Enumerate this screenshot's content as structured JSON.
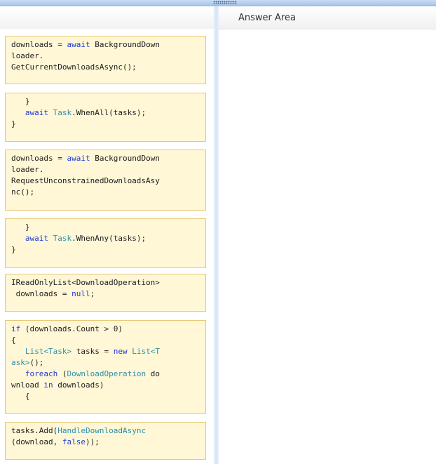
{
  "answer_area": {
    "title": "Answer Area"
  },
  "cards": [
    {
      "id": "c1",
      "lines": [
        [
          {
            "t": "downloads = "
          },
          {
            "t": "await",
            "c": "kw"
          },
          {
            "t": " BackgroundDown"
          }
        ],
        [
          {
            "t": "loader."
          }
        ],
        [
          {
            "t": "GetCurrentDownloadsAsync();"
          }
        ]
      ]
    },
    {
      "id": "c2",
      "lines": [
        [
          {
            "t": "   }"
          }
        ],
        [
          {
            "t": "   "
          },
          {
            "t": "await",
            "c": "kw"
          },
          {
            "t": " "
          },
          {
            "t": "Task",
            "c": "ty"
          },
          {
            "t": ".WhenAll(tasks);"
          }
        ],
        [
          {
            "t": "}"
          }
        ]
      ]
    },
    {
      "id": "c3",
      "lines": [
        [
          {
            "t": "downloads = "
          },
          {
            "t": "await",
            "c": "kw"
          },
          {
            "t": " BackgroundDown"
          }
        ],
        [
          {
            "t": "loader."
          }
        ],
        [
          {
            "t": "RequestUnconstrainedDownloadsAsy"
          }
        ],
        [
          {
            "t": "nc();"
          }
        ]
      ]
    },
    {
      "id": "c4",
      "lines": [
        [
          {
            "t": "   }"
          }
        ],
        [
          {
            "t": "   "
          },
          {
            "t": "await",
            "c": "kw"
          },
          {
            "t": " "
          },
          {
            "t": "Task",
            "c": "ty"
          },
          {
            "t": ".WhenAny(tasks);"
          }
        ],
        [
          {
            "t": "}"
          }
        ]
      ]
    },
    {
      "id": "c5",
      "lines": [
        [
          {
            "t": "IReadOnlyList<DownloadOperation>"
          }
        ],
        [
          {
            "t": " downloads = "
          },
          {
            "t": "null",
            "c": "kw"
          },
          {
            "t": ";"
          }
        ]
      ]
    },
    {
      "id": "c6",
      "lines": [
        [
          {
            "t": "if",
            "c": "kw"
          },
          {
            "t": " (downloads.Count > 0)"
          }
        ],
        [
          {
            "t": "{"
          }
        ],
        [
          {
            "t": "   "
          },
          {
            "t": "List<Task>",
            "c": "ty"
          },
          {
            "t": " tasks = "
          },
          {
            "t": "new",
            "c": "kw"
          },
          {
            "t": " "
          },
          {
            "t": "List<T",
            "c": "ty"
          }
        ],
        [
          {
            "t": "ask>",
            "c": "ty"
          },
          {
            "t": "();"
          }
        ],
        [
          {
            "t": "   "
          },
          {
            "t": "foreach",
            "c": "kw"
          },
          {
            "t": " ("
          },
          {
            "t": "DownloadOperation",
            "c": "ty"
          },
          {
            "t": " do"
          }
        ],
        [
          {
            "t": "wnload "
          },
          {
            "t": "in",
            "c": "kw"
          },
          {
            "t": " downloads)"
          }
        ],
        [
          {
            "t": "   {"
          }
        ]
      ]
    },
    {
      "id": "c7",
      "lines": [
        [
          {
            "t": "tasks.Add("
          },
          {
            "t": "HandleDownloadAsync",
            "c": "ty"
          }
        ],
        [
          {
            "t": "(download, "
          },
          {
            "t": "false",
            "c": "kw"
          },
          {
            "t": "));"
          }
        ]
      ]
    }
  ]
}
